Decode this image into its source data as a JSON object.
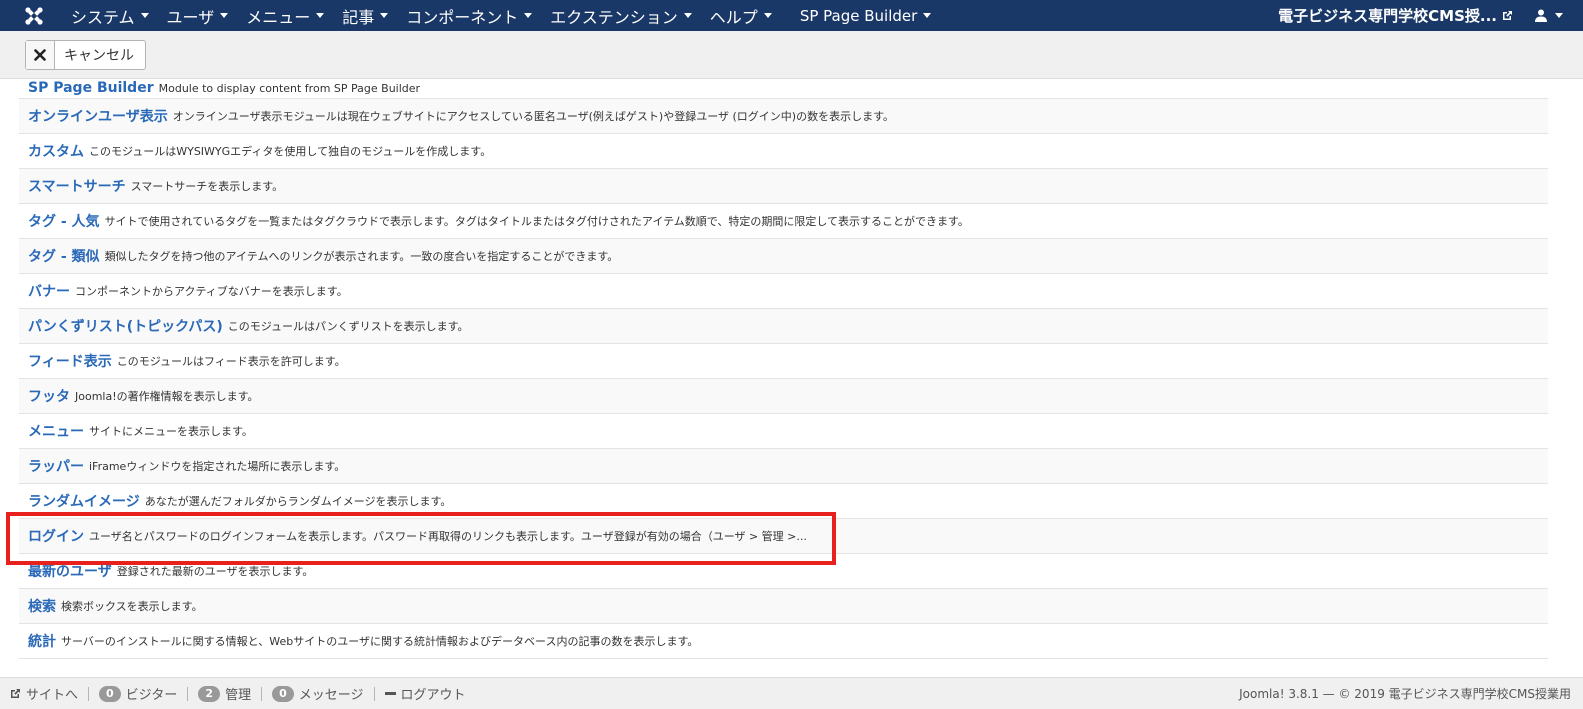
{
  "topbar": {
    "menu": [
      {
        "label": "システム"
      },
      {
        "label": "ユーザ"
      },
      {
        "label": "メニュー"
      },
      {
        "label": "記事"
      },
      {
        "label": "コンポーネント"
      },
      {
        "label": "エクステンション"
      },
      {
        "label": "ヘルプ"
      }
    ],
    "spb_label": "SP Page Builder",
    "site_name": "電子ビジネス専門学校CMS授...",
    "colors": {
      "bar": "#1a3867"
    }
  },
  "toolbar": {
    "cancel_label": "キャンセル"
  },
  "modules": [
    {
      "title": "SP Page Builder",
      "desc": "Module to display content from SP Page Builder"
    },
    {
      "title": "オンラインユーザ表示",
      "desc": "オンラインユーザ表示モジュールは現在ウェブサイトにアクセスしている匿名ユーザ(例えばゲスト)や登録ユーザ (ログイン中)の数を表示します。"
    },
    {
      "title": "カスタム",
      "desc": "このモジュールはWYSIWYGエディタを使用して独自のモジュールを作成します。"
    },
    {
      "title": "スマートサーチ",
      "desc": "スマートサーチを表示します。"
    },
    {
      "title": "タグ - 人気",
      "desc": "サイトで使用されているタグを一覧またはタグクラウドで表示します。タグはタイトルまたはタグ付けされたアイテム数順で、特定の期間に限定して表示することができます。"
    },
    {
      "title": "タグ - 類似",
      "desc": "類似したタグを持つ他のアイテムへのリンクが表示されます。一致の度合いを指定することができます。"
    },
    {
      "title": "バナー",
      "desc": "コンポーネントからアクティブなバナーを表示します。"
    },
    {
      "title": "パンくずリスト(トピックパス)",
      "desc": "このモジュールはパンくずリストを表示します。"
    },
    {
      "title": "フィード表示",
      "desc": "このモジュールはフィード表示を許可します。"
    },
    {
      "title": "フッタ",
      "desc": "Joomla!の著作権情報を表示します。"
    },
    {
      "title": "メニュー",
      "desc": "サイトにメニューを表示します。"
    },
    {
      "title": "ラッパー",
      "desc": "iFrameウィンドウを指定された場所に表示します。"
    },
    {
      "title": "ランダムイメージ",
      "desc": "あなたが選んだフォルダからランダムイメージを表示します。"
    },
    {
      "title": "ログイン",
      "desc": "ユーザ名とパスワードのログインフォームを表示します。パスワード再取得のリンクも表示します。ユーザ登録が有効の場合（ユーザ > 管理 >..."
    },
    {
      "title": "最新のユーザ",
      "desc": "登録された最新のユーザを表示します。"
    },
    {
      "title": "検索",
      "desc": "検索ボックスを表示します。"
    },
    {
      "title": "統計",
      "desc": "サーバーのインストールに関する情報と、Webサイトのユーザに関する統計情報およびデータベース内の記事の数を表示します。"
    }
  ],
  "highlight_color": "#e8201e",
  "statusbar": {
    "site_label": "サイトへ",
    "visitors_count": "0",
    "visitors_label": "ビジター",
    "admin_count": "2",
    "admin_label": "管理",
    "messages_count": "0",
    "messages_label": "メッセージ",
    "logout_label": "ログアウト",
    "footer": "Joomla! 3.8.1 — © 2019 電子ビジネス専門学校CMS授業用"
  }
}
